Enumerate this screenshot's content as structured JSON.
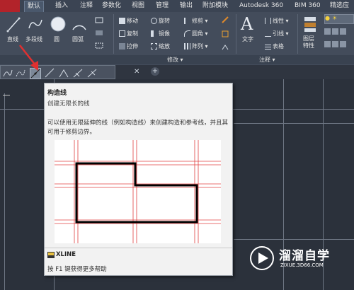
{
  "tabs": [
    "默认",
    "插入",
    "注释",
    "参数化",
    "视图",
    "管理",
    "输出",
    "附加模块",
    "Autodesk 360",
    "BIM 360",
    "精选应"
  ],
  "active_tab": "默认",
  "draw_panel": {
    "line_label": "直线",
    "polyline_label": "多段线",
    "circle_label": "圆",
    "arc_label": "圆弧"
  },
  "modify_panel": {
    "move": "移动",
    "rotate": "旋转",
    "trim": "修剪",
    "copy": "复制",
    "mirror": "镜像",
    "fillet": "圆角",
    "stretch": "拉伸",
    "scale": "缩放",
    "array": "阵列",
    "title": "修改"
  },
  "annotation_panel": {
    "text": "文字",
    "linear": "线性",
    "leader": "引线",
    "table": "表格",
    "title": "注释"
  },
  "layers_panel": {
    "layer_props": "图层\n特性"
  },
  "tooltip": {
    "title": "构造线",
    "subtitle": "创建无限长的线",
    "description": "可以使用无限延伸的线（例如构造线）来创建构造和参考线，并且其可用于修剪边界。",
    "command": "XLINE",
    "help": "按 F1 键获得更多帮助"
  },
  "watermark": {
    "name": "溜溜自学",
    "url": "ZIXUE.3D66.COM"
  },
  "colors": {
    "accent_red": "#e03030",
    "ribbon": "#434c5b",
    "canvas": "#2b313b"
  }
}
